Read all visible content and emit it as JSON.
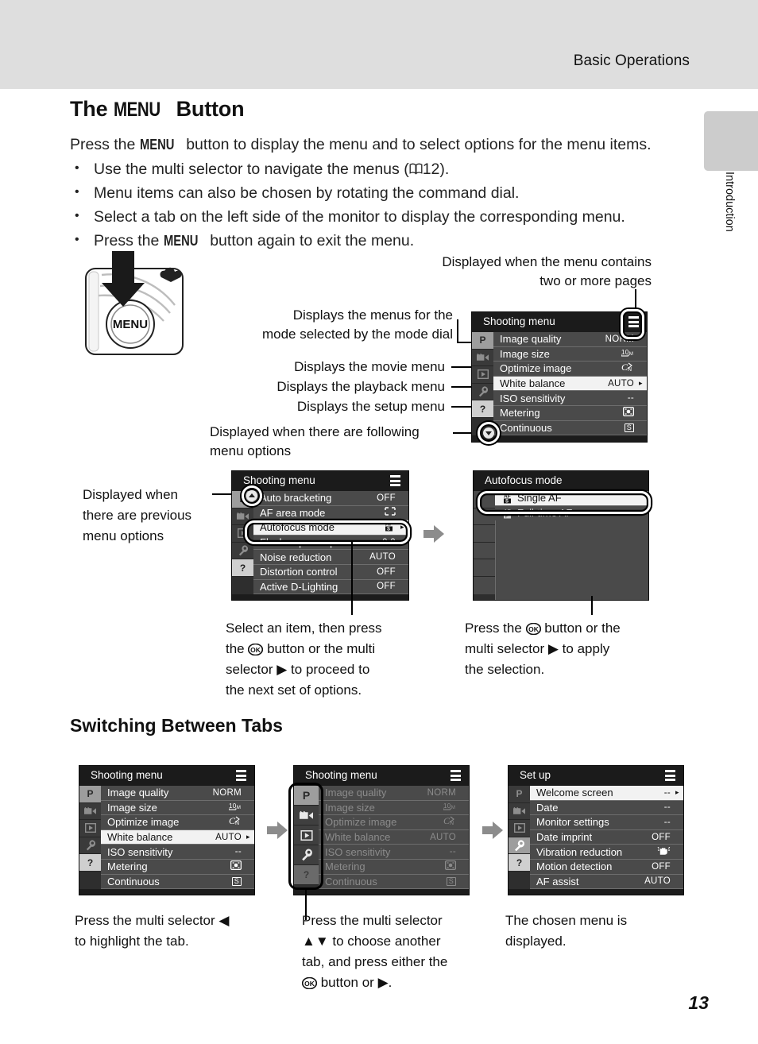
{
  "header": {
    "running_head": "Basic Operations",
    "side_tab_label": "Introduction",
    "page_number": "13"
  },
  "section": {
    "title_pre": "The ",
    "title_menu_word": "MENU",
    "title_post": " Button",
    "intro_pre": "Press the ",
    "intro_menu_word": "MENU",
    "intro_post": " button to display the menu and to select options for the menu items.",
    "bullets": [
      "Use the multi selector to navigate the menus (\u00012).",
      "Menu items can also be chosen by rotating the command dial.",
      "Select a tab on the left side of the monitor to display the corresponding menu.",
      "Press the MENU button again to exit the menu."
    ],
    "bullet1_a": "Use the multi selector to navigate the menus (",
    "bullet1_page": "12).",
    "bullet2": "Menu items can also be chosen by rotating the command dial.",
    "bullet3": "Select a tab on the left side of the monitor to display the corresponding menu.",
    "bullet4_a": "Press the ",
    "bullet4_menu": "MENU",
    "bullet4_b": " button again to exit the menu."
  },
  "sub_section": {
    "title": "Switching Between Tabs"
  },
  "callouts": {
    "pages_icon": "Displayed when the menu contains\ntwo or more pages",
    "mode_dial": "Displays the menus for the\nmode selected by the mode dial",
    "movie_menu": "Displays the movie menu",
    "playback_menu": "Displays the playback menu",
    "setup_menu": "Displays the setup menu",
    "following_options": "Displayed when there are following\nmenu options",
    "previous_options": "Displayed when\nthere are previous\nmenu options",
    "select_item": "Select an item, then press the Ⓚ button or the multi selector ▶ to proceed to the next set of options.",
    "select_item_l1": "Select an item, then press",
    "select_item_l2_a": "the ",
    "select_item_l2_b": " button or the multi",
    "select_item_l3_a": "selector ",
    "select_item_l3_b": " to proceed to",
    "select_item_l4": "the next set of options.",
    "apply_l1_a": "Press the ",
    "apply_l1_b": " button or the",
    "apply_l2_a": "multi selector ",
    "apply_l2_b": " to apply",
    "apply_l3": "the selection.",
    "tabs_step1_l1_a": "Press the multi selector ",
    "tabs_step1_l2": "to highlight the tab.",
    "tabs_step2_l1": "Press the multi selector",
    "tabs_step2_l2_b": " to choose another",
    "tabs_step2_l3": "tab, and press either the",
    "tabs_step2_l4_b": " button or ",
    "tabs_step3_l1": "The chosen menu is",
    "tabs_step3_l2": "displayed."
  },
  "camera_illustration": {
    "button_label": "MENU",
    "icon": "down-arrow-icon"
  },
  "screens": {
    "shooting_main": {
      "title": "Shooting menu",
      "tabs": [
        {
          "icon": "P",
          "name": "tab-shooting",
          "state": "active"
        },
        {
          "icon": "movie",
          "name": "tab-movie",
          "state": "normal"
        },
        {
          "icon": "playback",
          "name": "tab-playback",
          "state": "normal"
        },
        {
          "icon": "wrench",
          "name": "tab-setup",
          "state": "normal"
        },
        {
          "icon": "question",
          "name": "tab-help",
          "state": "help"
        }
      ],
      "rows": [
        {
          "label": "Image quality",
          "value": "NORM",
          "selected": false
        },
        {
          "label": "Image size",
          "value": "10M",
          "selected": false
        },
        {
          "label": "Optimize image",
          "value": "CN",
          "selected": false
        },
        {
          "label": "White balance",
          "value": "AUTO",
          "selected": true,
          "caret": true
        },
        {
          "label": "ISO sensitivity",
          "value": "--",
          "selected": false
        },
        {
          "label": "Metering",
          "value": "matrix",
          "selected": false
        },
        {
          "label": "Continuous",
          "value": "S",
          "selected": false
        }
      ]
    },
    "shooting_page2": {
      "title": "Shooting menu",
      "rows": [
        {
          "label": "Auto bracketing",
          "value": "OFF",
          "selected": false
        },
        {
          "label": "AF area mode",
          "value": "area",
          "selected": false
        },
        {
          "label": "Autofocus mode",
          "value": "AF-S",
          "selected": true,
          "caret": true
        },
        {
          "label": "Flash exp. comp.",
          "value": "0.0",
          "selected": false
        },
        {
          "label": "Noise reduction",
          "value": "AUTO",
          "selected": false
        },
        {
          "label": "Distortion control",
          "value": "OFF",
          "selected": false
        },
        {
          "label": "Active D-Lighting",
          "value": "OFF",
          "selected": false
        }
      ]
    },
    "autofocus": {
      "title": "Autofocus mode",
      "rows": [
        {
          "label": "Single AF",
          "value": "AF-S",
          "selected": true
        },
        {
          "label": "Full-time AF",
          "value": "AF-F",
          "selected": false
        }
      ]
    },
    "tabs_step1": {
      "title": "Shooting menu",
      "rows": [
        {
          "label": "Image quality",
          "value": "NORM",
          "selected": false
        },
        {
          "label": "Image size",
          "value": "10M",
          "selected": false
        },
        {
          "label": "Optimize image",
          "value": "CN",
          "selected": false
        },
        {
          "label": "White balance",
          "value": "AUTO",
          "selected": true,
          "caret": true
        },
        {
          "label": "ISO sensitivity",
          "value": "--",
          "selected": false
        },
        {
          "label": "Metering",
          "value": "matrix",
          "selected": false
        },
        {
          "label": "Continuous",
          "value": "S",
          "selected": false
        }
      ]
    },
    "tabs_step2": {
      "title": "Shooting menu",
      "rows": [
        {
          "label": "Image quality",
          "value": "NORM",
          "selected": false
        },
        {
          "label": "Image size",
          "value": "10M",
          "selected": false
        },
        {
          "label": "Optimize image",
          "value": "CN",
          "selected": false
        },
        {
          "label": "White balance",
          "value": "AUTO",
          "selected": false
        },
        {
          "label": "ISO sensitivity",
          "value": "--",
          "selected": false
        },
        {
          "label": "Metering",
          "value": "matrix",
          "selected": false
        },
        {
          "label": "Continuous",
          "value": "S",
          "selected": false
        }
      ]
    },
    "setup": {
      "title": "Set up",
      "rows": [
        {
          "label": "Welcome screen",
          "value": "--",
          "selected": true,
          "caret": true
        },
        {
          "label": "Date",
          "value": "--",
          "selected": false
        },
        {
          "label": "Monitor settings",
          "value": "--",
          "selected": false
        },
        {
          "label": "Date imprint",
          "value": "OFF",
          "selected": false
        },
        {
          "label": "Vibration reduction",
          "value": "VR",
          "selected": false
        },
        {
          "label": "Motion detection",
          "value": "OFF",
          "selected": false
        },
        {
          "label": "AF assist",
          "value": "AUTO",
          "selected": false
        }
      ]
    }
  },
  "colors": {
    "header_bg": "#dedede",
    "side_tab_bg": "#cccccc",
    "screen_bg": "#1c1c1c",
    "row_bg": "#4a4a4a",
    "row_selected_bg": "#f2f2f2",
    "arrow_grey": "#8c8c8c"
  }
}
